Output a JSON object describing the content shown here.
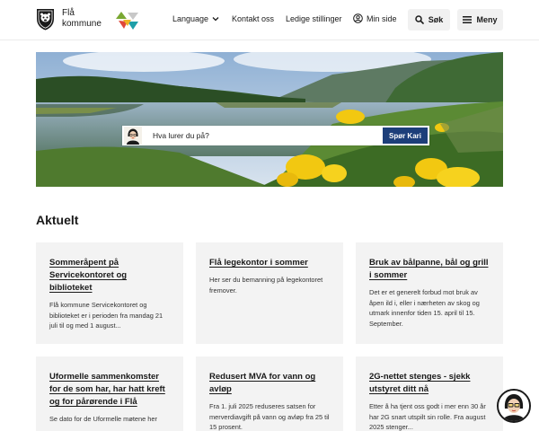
{
  "header": {
    "brand_line1": "Flå",
    "brand_line2": "kommune",
    "nav": {
      "language": "Language",
      "contact": "Kontakt oss",
      "jobs": "Ledige stillinger",
      "my_page": "Min side"
    },
    "search_label": "Søk",
    "menu_label": "Meny"
  },
  "icons": {
    "logo": "coat-of-arms-icon",
    "mark": "triangles-logo-icon",
    "language": "chevron-down-icon",
    "user": "user-icon",
    "search": "search-icon",
    "menu": "hamburger-icon",
    "chat": "chat-assistant-avatar-icon"
  },
  "colors": {
    "accent": "#1d3f7a",
    "card_bg": "#f3f3f3",
    "button_bg": "#f1f1f1"
  },
  "hero": {
    "ask": {
      "placeholder": "Hva lurer du på?",
      "button": "Spør Kari"
    }
  },
  "news": {
    "title": "Aktuelt",
    "items": [
      {
        "title": "Sommeråpent på Servicekontoret og biblioteket",
        "text": "Flå kommune Servicekontoret og biblioteket er i perioden fra mandag 21 juli til og med 1 august..."
      },
      {
        "title": "Flå legekontor i sommer",
        "text": "Her ser du bemanning på legekontoret fremover."
      },
      {
        "title": "Bruk av bålpanne, bål og grill i sommer",
        "text": "Det er et generelt forbud mot bruk av åpen ild i, eller i nærheten av skog og utmark innenfor tiden 15. april til 15. September."
      },
      {
        "title": "Uformelle sammenkomster for de som har, har hatt kreft og for pårørende i Flå",
        "text": "Se dato for de Uformelle møtene her"
      },
      {
        "title": "Redusert MVA for vann og avløp",
        "text": "Fra 1. juli 2025 reduseres satsen for merverdiavgift på vann og avløp fra 25 til 15 prosent."
      },
      {
        "title": "2G-nettet stenges - sjekk utstyret ditt nå",
        "text": "Etter å ha tjent oss godt i mer enn 30 år har 2G snart utspilt sin rolle. Fra august 2025 stenger..."
      }
    ]
  }
}
